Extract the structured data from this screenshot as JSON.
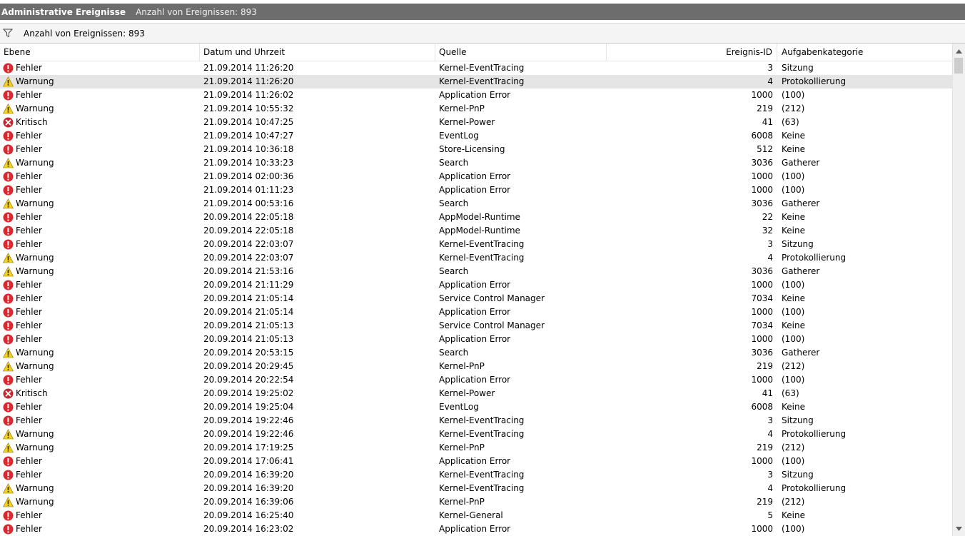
{
  "title": {
    "main": "Administrative Ereignisse",
    "count": "Anzahl von Ereignissen: 893"
  },
  "filter": {
    "icon": "filter-icon",
    "text": "Anzahl von Ereignissen: 893"
  },
  "columns": {
    "level": "Ebene",
    "date": "Datum und Uhrzeit",
    "source": "Quelle",
    "event_id": "Ereignis-ID",
    "category": "Aufgabenkategorie"
  },
  "colors": {
    "error": "#e0262d",
    "warning": "#f5d21a",
    "critical": "#c9252c",
    "titlebar": "#6d6d6d",
    "selected_row": "#e5e5e5"
  },
  "events": [
    {
      "level": "Fehler",
      "type": "error",
      "date": "21.09.2014 11:26:20",
      "source": "Kernel-EventTracing",
      "id": "3",
      "category": "Sitzung"
    },
    {
      "level": "Warnung",
      "type": "warning",
      "date": "21.09.2014 11:26:20",
      "source": "Kernel-EventTracing",
      "id": "4",
      "category": "Protokollierung",
      "selected": true
    },
    {
      "level": "Fehler",
      "type": "error",
      "date": "21.09.2014 11:26:02",
      "source": "Application Error",
      "id": "1000",
      "category": "(100)"
    },
    {
      "level": "Warnung",
      "type": "warning",
      "date": "21.09.2014 10:55:32",
      "source": "Kernel-PnP",
      "id": "219",
      "category": "(212)"
    },
    {
      "level": "Kritisch",
      "type": "critical",
      "date": "21.09.2014 10:47:25",
      "source": "Kernel-Power",
      "id": "41",
      "category": "(63)"
    },
    {
      "level": "Fehler",
      "type": "error",
      "date": "21.09.2014 10:47:27",
      "source": "EventLog",
      "id": "6008",
      "category": "Keine"
    },
    {
      "level": "Fehler",
      "type": "error",
      "date": "21.09.2014 10:36:18",
      "source": "Store-Licensing",
      "id": "512",
      "category": "Keine"
    },
    {
      "level": "Warnung",
      "type": "warning",
      "date": "21.09.2014 10:33:23",
      "source": "Search",
      "id": "3036",
      "category": "Gatherer"
    },
    {
      "level": "Fehler",
      "type": "error",
      "date": "21.09.2014 02:00:36",
      "source": "Application Error",
      "id": "1000",
      "category": "(100)"
    },
    {
      "level": "Fehler",
      "type": "error",
      "date": "21.09.2014 01:11:23",
      "source": "Application Error",
      "id": "1000",
      "category": "(100)"
    },
    {
      "level": "Warnung",
      "type": "warning",
      "date": "21.09.2014 00:53:16",
      "source": "Search",
      "id": "3036",
      "category": "Gatherer"
    },
    {
      "level": "Fehler",
      "type": "error",
      "date": "20.09.2014 22:05:18",
      "source": "AppModel-Runtime",
      "id": "22",
      "category": "Keine"
    },
    {
      "level": "Fehler",
      "type": "error",
      "date": "20.09.2014 22:05:18",
      "source": "AppModel-Runtime",
      "id": "32",
      "category": "Keine"
    },
    {
      "level": "Fehler",
      "type": "error",
      "date": "20.09.2014 22:03:07",
      "source": "Kernel-EventTracing",
      "id": "3",
      "category": "Sitzung"
    },
    {
      "level": "Warnung",
      "type": "warning",
      "date": "20.09.2014 22:03:07",
      "source": "Kernel-EventTracing",
      "id": "4",
      "category": "Protokollierung"
    },
    {
      "level": "Warnung",
      "type": "warning",
      "date": "20.09.2014 21:53:16",
      "source": "Search",
      "id": "3036",
      "category": "Gatherer"
    },
    {
      "level": "Fehler",
      "type": "error",
      "date": "20.09.2014 21:11:29",
      "source": "Application Error",
      "id": "1000",
      "category": "(100)"
    },
    {
      "level": "Fehler",
      "type": "error",
      "date": "20.09.2014 21:05:14",
      "source": "Service Control Manager",
      "id": "7034",
      "category": "Keine"
    },
    {
      "level": "Fehler",
      "type": "error",
      "date": "20.09.2014 21:05:14",
      "source": "Application Error",
      "id": "1000",
      "category": "(100)"
    },
    {
      "level": "Fehler",
      "type": "error",
      "date": "20.09.2014 21:05:13",
      "source": "Service Control Manager",
      "id": "7034",
      "category": "Keine"
    },
    {
      "level": "Fehler",
      "type": "error",
      "date": "20.09.2014 21:05:13",
      "source": "Application Error",
      "id": "1000",
      "category": "(100)"
    },
    {
      "level": "Warnung",
      "type": "warning",
      "date": "20.09.2014 20:53:15",
      "source": "Search",
      "id": "3036",
      "category": "Gatherer"
    },
    {
      "level": "Warnung",
      "type": "warning",
      "date": "20.09.2014 20:29:45",
      "source": "Kernel-PnP",
      "id": "219",
      "category": "(212)"
    },
    {
      "level": "Fehler",
      "type": "error",
      "date": "20.09.2014 20:22:54",
      "source": "Application Error",
      "id": "1000",
      "category": "(100)"
    },
    {
      "level": "Kritisch",
      "type": "critical",
      "date": "20.09.2014 19:25:02",
      "source": "Kernel-Power",
      "id": "41",
      "category": "(63)"
    },
    {
      "level": "Fehler",
      "type": "error",
      "date": "20.09.2014 19:25:04",
      "source": "EventLog",
      "id": "6008",
      "category": "Keine"
    },
    {
      "level": "Fehler",
      "type": "error",
      "date": "20.09.2014 19:22:46",
      "source": "Kernel-EventTracing",
      "id": "3",
      "category": "Sitzung"
    },
    {
      "level": "Warnung",
      "type": "warning",
      "date": "20.09.2014 19:22:46",
      "source": "Kernel-EventTracing",
      "id": "4",
      "category": "Protokollierung"
    },
    {
      "level": "Warnung",
      "type": "warning",
      "date": "20.09.2014 17:19:25",
      "source": "Kernel-PnP",
      "id": "219",
      "category": "(212)"
    },
    {
      "level": "Fehler",
      "type": "error",
      "date": "20.09.2014 17:06:41",
      "source": "Application Error",
      "id": "1000",
      "category": "(100)"
    },
    {
      "level": "Fehler",
      "type": "error",
      "date": "20.09.2014 16:39:20",
      "source": "Kernel-EventTracing",
      "id": "3",
      "category": "Sitzung"
    },
    {
      "level": "Warnung",
      "type": "warning",
      "date": "20.09.2014 16:39:20",
      "source": "Kernel-EventTracing",
      "id": "4",
      "category": "Protokollierung"
    },
    {
      "level": "Warnung",
      "type": "warning",
      "date": "20.09.2014 16:39:06",
      "source": "Kernel-PnP",
      "id": "219",
      "category": "(212)"
    },
    {
      "level": "Fehler",
      "type": "error",
      "date": "20.09.2014 16:25:40",
      "source": "Kernel-General",
      "id": "5",
      "category": "Keine"
    },
    {
      "level": "Fehler",
      "type": "error",
      "date": "20.09.2014 16:23:02",
      "source": "Application Error",
      "id": "1000",
      "category": "(100)"
    }
  ]
}
